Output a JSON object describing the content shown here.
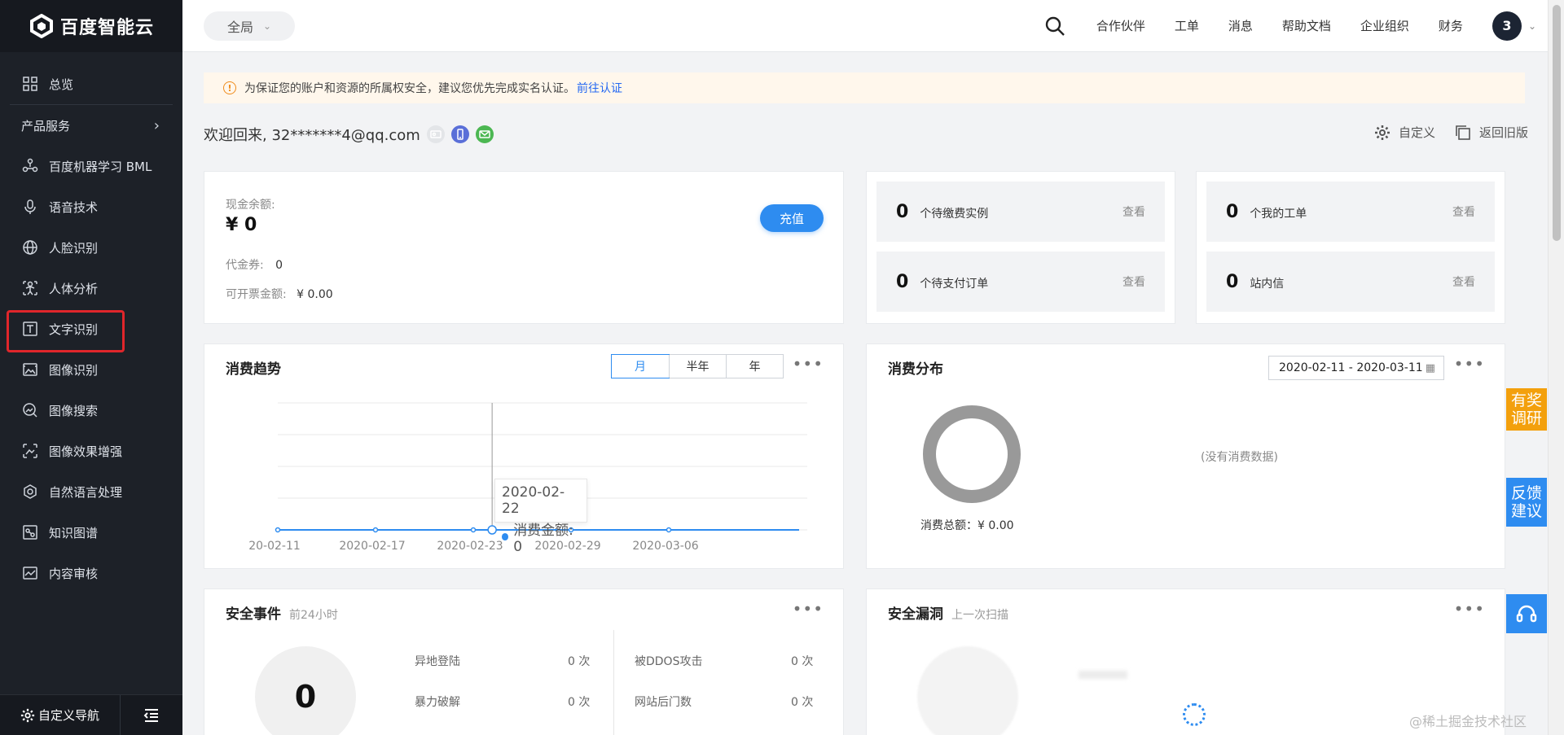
{
  "brand": {
    "name": "百度智能云"
  },
  "sidebar": {
    "overview_label": "总览",
    "section_label": "产品服务",
    "items": [
      {
        "label": "百度机器学习 BML",
        "icon": "bml-icon"
      },
      {
        "label": "语音技术",
        "icon": "microphone-icon"
      },
      {
        "label": "人脸识别",
        "icon": "face-icon"
      },
      {
        "label": "人体分析",
        "icon": "body-icon"
      },
      {
        "label": "文字识别",
        "icon": "text-icon"
      },
      {
        "label": "图像识别",
        "icon": "image-icon"
      },
      {
        "label": "图像搜索",
        "icon": "image-search-icon"
      },
      {
        "label": "图像效果增强",
        "icon": "image-enhance-icon"
      },
      {
        "label": "自然语言处理",
        "icon": "nlp-icon"
      },
      {
        "label": "知识图谱",
        "icon": "knowledge-graph-icon"
      },
      {
        "label": "内容审核",
        "icon": "content-audit-icon"
      }
    ],
    "footer_label": "自定义导航"
  },
  "topbar": {
    "scope_label": "全局",
    "links": [
      "合作伙伴",
      "工单",
      "消息",
      "帮助文档",
      "企业组织",
      "财务"
    ],
    "avatar_text": "3"
  },
  "notice": {
    "text": "为保证您的账户和资源的所属权安全，建议您优先完成实名认证。",
    "link_text": "前往认证"
  },
  "welcome": {
    "text": "欢迎回来, 32*******4@qq.com"
  },
  "page_tools": {
    "customize_label": "自定义",
    "legacy_label": "返回旧版"
  },
  "balance": {
    "cash_label": "现金余额:",
    "cash_value": "¥ 0",
    "voucher_label": "代金券:",
    "voucher_value": "0",
    "invoice_label": "可开票金额:",
    "invoice_value": "¥ 0.00",
    "recharge_label": "充值"
  },
  "stats": {
    "pending_instances": {
      "num": "0",
      "label": "个待缴费实例",
      "action": "查看"
    },
    "pending_orders": {
      "num": "0",
      "label": "个待支付订单",
      "action": "查看"
    },
    "my_tickets": {
      "num": "0",
      "label": "个我的工单",
      "action": "查看"
    },
    "inbox": {
      "num": "0",
      "label": "站内信",
      "action": "查看"
    }
  },
  "trend": {
    "title": "消费趋势",
    "tabs": [
      "月",
      "半年",
      "年"
    ],
    "tooltip_date": "2020-02-22",
    "tooltip_label": "消费金额: 0"
  },
  "distribution": {
    "title": "消费分布",
    "date_range": "2020-02-11 - 2020-03-11",
    "empty_text": "(没有消费数据)",
    "total_label": "消费总额：¥ 0.00"
  },
  "security_events": {
    "title": "安全事件",
    "subtitle": "前24小时",
    "total": "0",
    "rows": [
      {
        "label": "异地登陆",
        "value": "0 次"
      },
      {
        "label": "被DDOS攻击",
        "value": "0 次"
      },
      {
        "label": "暴力破解",
        "value": "0 次"
      },
      {
        "label": "网站后门数",
        "value": "0 次"
      }
    ]
  },
  "security_vuln": {
    "title": "安全漏洞",
    "subtitle": "上一次扫描"
  },
  "floats": {
    "survey": "有奖\n调研",
    "feedback": "反馈\n建议"
  },
  "watermark": "@稀土掘金技术社区",
  "chart_data": {
    "type": "line",
    "x": [
      "2020-02-11",
      "2020-02-17",
      "2020-02-23",
      "2020-02-29",
      "2020-03-06"
    ],
    "x_tick_labels": [
      "20-02-11",
      "2020-02-17",
      "2020-02-23",
      "2020-02-29",
      "2020-03-06"
    ],
    "series": [
      {
        "values": [
          0,
          0,
          0,
          0,
          0
        ]
      }
    ],
    "ylim": [
      0,
      1
    ],
    "grid": true,
    "color": "#2e8cf0"
  },
  "colors": {
    "accent": "#2e8cf0",
    "sidebar": "#1d2128",
    "warn": "#f08c1c",
    "survey": "#f3a00d"
  }
}
